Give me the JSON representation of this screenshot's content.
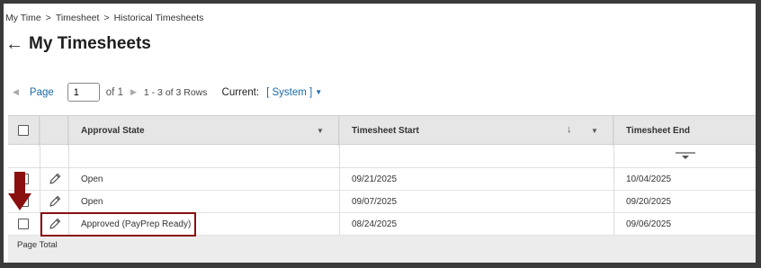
{
  "breadcrumb": {
    "items": [
      "My Time",
      "Timesheet",
      "Historical Timesheets"
    ],
    "separator": ">"
  },
  "page": {
    "back_icon": "back-arrow-icon",
    "title": "My Timesheets"
  },
  "pager": {
    "prev_icon": "prev-page-icon",
    "page_label": "Page",
    "page_value": "1",
    "of_label": "of 1",
    "next_icon": "next-page-icon",
    "rows_label": "1 - 3 of 3 Rows",
    "current_label": "Current:",
    "current_value": "[ System ]",
    "current_caret_icon": "chevron-down-icon"
  },
  "table": {
    "columns": [
      {
        "key": "select",
        "label": ""
      },
      {
        "key": "edit",
        "label": ""
      },
      {
        "key": "approval_state",
        "label": "Approval State",
        "icons": [
          "dropdown-icon"
        ]
      },
      {
        "key": "timesheet_start",
        "label": "Timesheet Start",
        "icons": [
          "sort-down-icon",
          "dropdown-icon"
        ]
      },
      {
        "key": "timesheet_end",
        "label": "Timesheet End"
      }
    ],
    "rows": [
      {
        "approval_state": "Open",
        "timesheet_start": "09/21/2025",
        "timesheet_end": "10/04/2025"
      },
      {
        "approval_state": "Open",
        "timesheet_start": "09/07/2025",
        "timesheet_end": "09/20/2025"
      },
      {
        "approval_state": "Approved (PayPrep Ready)",
        "timesheet_start": "08/24/2025",
        "timesheet_end": "09/06/2025"
      }
    ],
    "footer_label": "Page Total"
  },
  "annotation": {
    "arrow_color": "#8a1010",
    "box_color": "#8a1010"
  },
  "colors": {
    "link": "#1a6aa8",
    "header_bg": "#e6e6e6",
    "frame": "#3a3a3a"
  }
}
